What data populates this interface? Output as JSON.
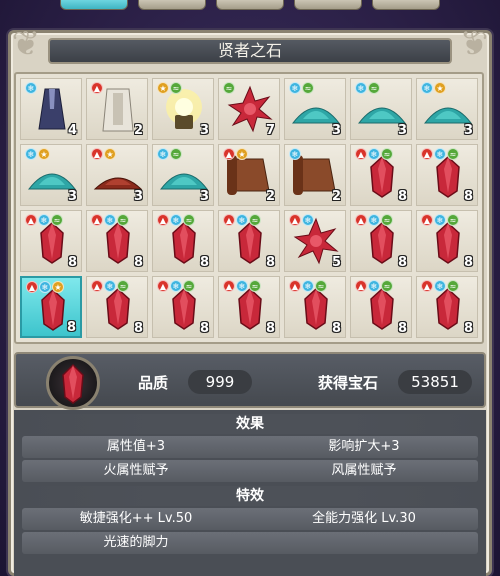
{
  "title": "贤者之石",
  "colors": {
    "fire": "#d9342b",
    "ice": "#3fb5e0",
    "wind": "#55a83a",
    "light": "#e0a020"
  },
  "items": [
    {
      "icon": "robe-icon",
      "badges": [
        "ice"
      ],
      "count": "4"
    },
    {
      "icon": "white-robe-icon",
      "badges": [
        "fire"
      ],
      "count": "2"
    },
    {
      "icon": "glowing-lamp-icon",
      "badges": [
        "light",
        "wind"
      ],
      "count": "3"
    },
    {
      "icon": "red-crystal-cluster-icon",
      "badges": [
        "wind"
      ],
      "count": "7"
    },
    {
      "icon": "teal-powder-pile-icon",
      "badges": [
        "ice",
        "wind"
      ],
      "count": "3"
    },
    {
      "icon": "teal-powder-pile-icon",
      "badges": [
        "ice",
        "wind"
      ],
      "count": "3"
    },
    {
      "icon": "teal-powder-pile-icon",
      "badges": [
        "ice",
        "light"
      ],
      "count": "3"
    },
    {
      "icon": "teal-powder-pile-icon",
      "badges": [
        "ice",
        "light"
      ],
      "count": "3"
    },
    {
      "icon": "red-powder-pile-icon",
      "badges": [
        "fire",
        "light"
      ],
      "count": "3"
    },
    {
      "icon": "teal-powder-pile-icon",
      "badges": [
        "ice",
        "wind"
      ],
      "count": "3"
    },
    {
      "icon": "scroll-icon",
      "badges": [
        "fire",
        "light"
      ],
      "count": "2"
    },
    {
      "icon": "scroll-icon",
      "badges": [
        "ice"
      ],
      "count": "2"
    },
    {
      "icon": "red-crystal-icon",
      "badges": [
        "fire",
        "ice",
        "wind"
      ],
      "count": "8"
    },
    {
      "icon": "red-crystal-icon",
      "badges": [
        "fire",
        "ice",
        "wind"
      ],
      "count": "8"
    },
    {
      "icon": "red-crystal-icon",
      "badges": [
        "fire",
        "ice",
        "wind"
      ],
      "count": "8"
    },
    {
      "icon": "red-crystal-icon",
      "badges": [
        "fire",
        "ice",
        "wind"
      ],
      "count": "8"
    },
    {
      "icon": "red-crystal-icon",
      "badges": [
        "fire",
        "ice",
        "wind"
      ],
      "count": "8"
    },
    {
      "icon": "red-crystal-icon",
      "badges": [
        "fire",
        "ice",
        "wind"
      ],
      "count": "8"
    },
    {
      "icon": "red-crystal-cluster-icon",
      "badges": [
        "fire",
        "ice"
      ],
      "count": "5"
    },
    {
      "icon": "red-crystal-icon",
      "badges": [
        "fire",
        "ice",
        "wind"
      ],
      "count": "8"
    },
    {
      "icon": "red-crystal-icon",
      "badges": [
        "fire",
        "ice",
        "wind"
      ],
      "count": "8"
    },
    {
      "icon": "red-crystal-icon",
      "badges": [
        "fire",
        "ice",
        "light"
      ],
      "count": "8",
      "selected": true
    },
    {
      "icon": "red-crystal-icon",
      "badges": [
        "fire",
        "ice",
        "wind"
      ],
      "count": "8"
    },
    {
      "icon": "red-crystal-icon",
      "badges": [
        "fire",
        "ice",
        "wind"
      ],
      "count": "8"
    },
    {
      "icon": "red-crystal-icon",
      "badges": [
        "fire",
        "ice",
        "wind"
      ],
      "count": "8"
    },
    {
      "icon": "red-crystal-icon",
      "badges": [
        "fire",
        "ice",
        "wind"
      ],
      "count": "8"
    },
    {
      "icon": "red-crystal-icon",
      "badges": [
        "fire",
        "ice",
        "wind"
      ],
      "count": "8"
    },
    {
      "icon": "red-crystal-icon",
      "badges": [
        "fire",
        "ice",
        "wind"
      ],
      "count": "8"
    }
  ],
  "info": {
    "quality_label": "品质",
    "quality_value": "999",
    "gems_label": "获得宝石",
    "gems_value": "53851"
  },
  "effects": {
    "header": "效果",
    "rows": [
      [
        "属性值+3",
        "影响扩大+3"
      ],
      [
        "火属性赋予",
        "风属性赋予"
      ]
    ]
  },
  "traits": {
    "header": "特效",
    "rows": [
      [
        "敏捷强化++ Lv.50",
        "全能力强化 Lv.30"
      ],
      [
        "光速的脚力",
        ""
      ]
    ]
  }
}
